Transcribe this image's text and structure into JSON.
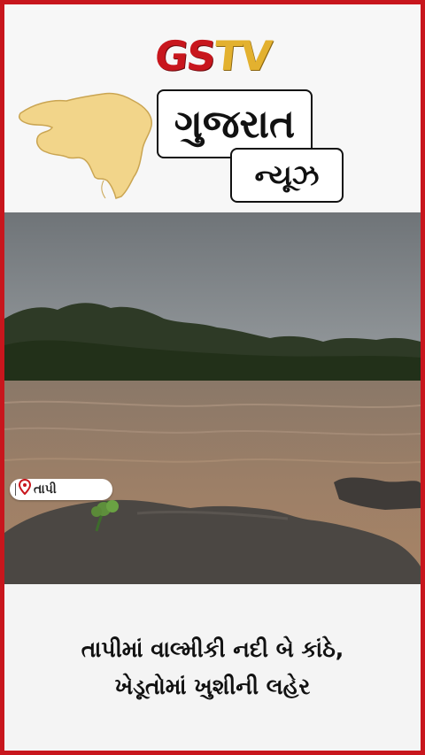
{
  "header": {
    "logo_gs": "GS",
    "logo_tv": "TV",
    "title": "ગુજરાત",
    "subtitle": "ન્યૂઝ"
  },
  "photo": {
    "location_icon": "map-pin-icon",
    "location_label": "તાપી"
  },
  "caption": {
    "line1": "તાપીમાં વાલ્મીકી નદી બે કાંઠે,",
    "line2": "ખેડૂતોમાં  ખુશીની લહેર"
  },
  "colors": {
    "border": "#c8161d",
    "logo_red": "#c8161d",
    "logo_gold": "#e3b12f",
    "map_fill": "#f2d58a"
  }
}
